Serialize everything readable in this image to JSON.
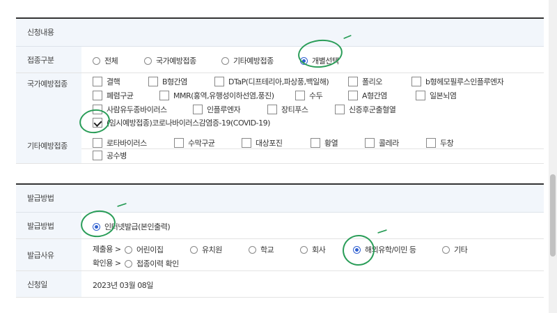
{
  "section1": {
    "title": "신청내용",
    "rows": {
      "type": {
        "label": "접종구분",
        "options": [
          "전체",
          "국가예방접종",
          "기타예방접종",
          "개별선택"
        ],
        "selected": "개별선택"
      },
      "national": {
        "label": "국가예방접종",
        "options": [
          "결핵",
          "B형간염",
          "DTaP(디프테리아,파상풍,백일해)",
          "폴리오",
          "b형헤모필루스인플루엔자",
          "폐렴구균",
          "MMR(홍역,유행성이하선염,풍진)",
          "수두",
          "A형간염",
          "일본뇌염",
          "사람유두종바이러스",
          "인플루엔자",
          "장티푸스",
          "신증후군출혈열",
          "(임시예방접종)코로나바이러스감염증-19(COVID-19)"
        ],
        "checked": [
          "(임시예방접종)코로나바이러스감염증-19(COVID-19)"
        ]
      },
      "other": {
        "label": "기타예방접종",
        "options": [
          "로타바이러스",
          "수막구균",
          "대상포진",
          "황열",
          "콜레라",
          "두창",
          "공수병"
        ]
      }
    }
  },
  "section2": {
    "title": "발급방법",
    "rows": {
      "method": {
        "label": "발급방법",
        "options": [
          "인터넷발급(본인출력)"
        ],
        "selected": "인터넷발급(본인출력)"
      },
      "reason": {
        "label": "발급사유",
        "submit_prefix": "제출용 >",
        "submit_options": [
          "어린이집",
          "유치원",
          "학교",
          "회사",
          "해외유학/이민 등",
          "기타"
        ],
        "selected": "해외유학/이민 등",
        "confirm_prefix": "확인용 >",
        "confirm_options": [
          "접종이력 확인"
        ]
      },
      "date": {
        "label": "신청일",
        "value": "2023년 03월 08일"
      }
    }
  },
  "colors": {
    "accent": "#2f5fd0",
    "highlight": "#2a9d58",
    "label_bg": "#f2f6fb"
  }
}
